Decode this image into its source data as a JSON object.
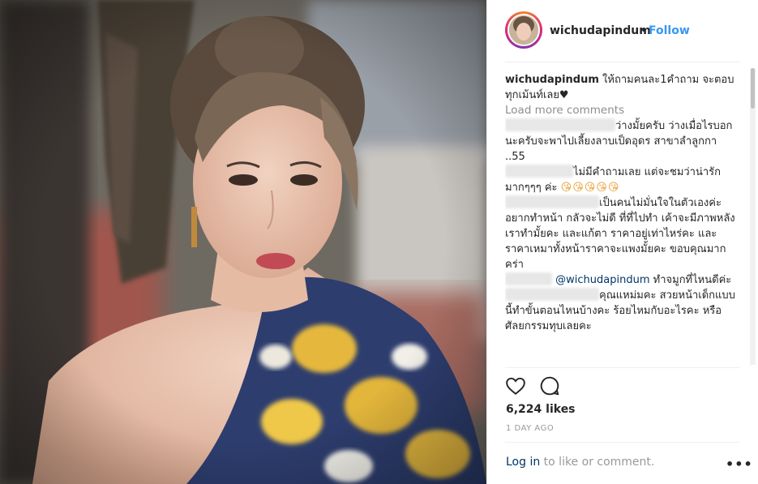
{
  "post": {
    "username": "wichudapindum",
    "follow_label": "Follow",
    "separator": "•",
    "caption": "ให้ถามคนละ1คำถาม จะตอบทุกเม้นท์เลย♥",
    "load_more": "Load more comments",
    "likes": "6,224 likes",
    "time": "1 DAY AGO",
    "login_link": "Log in",
    "login_rest": " to like or comment.",
    "more_options": "•••"
  },
  "comments": [
    {
      "text": "ว่างมั้ยครับ ว่างเมื่อไรบอกนะครับจะพาไปเลี้ยงลาบเป็ดอุดร สาขาลำลูกกา ..55"
    },
    {
      "text": "ไม่มีคำถามเลย แต่จะชมว่าน่ารักมากๆๆๆ ค่ะ",
      "emoji": "😘😘😘😘😘"
    },
    {
      "text": "เป็นคนไม่มั่นใจในตัวเองค่ะ อยากทำหน้า กลัวจะไม่ดี ที่ที่ไปทำ เค้าจะมีภาพหลังเราทำมั้ยคะ และแก้ตา ราคาอยู่เท่าไหร่คะ และราคาเหมาทั้งหน้าราคาจะแพงมั้ยคะ ขอบคุณมากคร่า"
    },
    {
      "mention": "@wichudapindum",
      "text": " ทำจมูกที่ไหนดีค่ะ"
    },
    {
      "text": "คุณแหม่มคะ สวยหน้าเด็กแบบนี้ทำขั้นตอนไหนบ้างคะ ร้อยไหมกับอะไรคะ หรือศัลยกรรมทุบเลยคะ"
    }
  ],
  "colors": {
    "follow": "#3897f0",
    "mention": "#003569",
    "muted": "#8e8e8e",
    "text": "#262626"
  },
  "icons": [
    "heart-icon",
    "comment-icon",
    "more-options-icon"
  ]
}
